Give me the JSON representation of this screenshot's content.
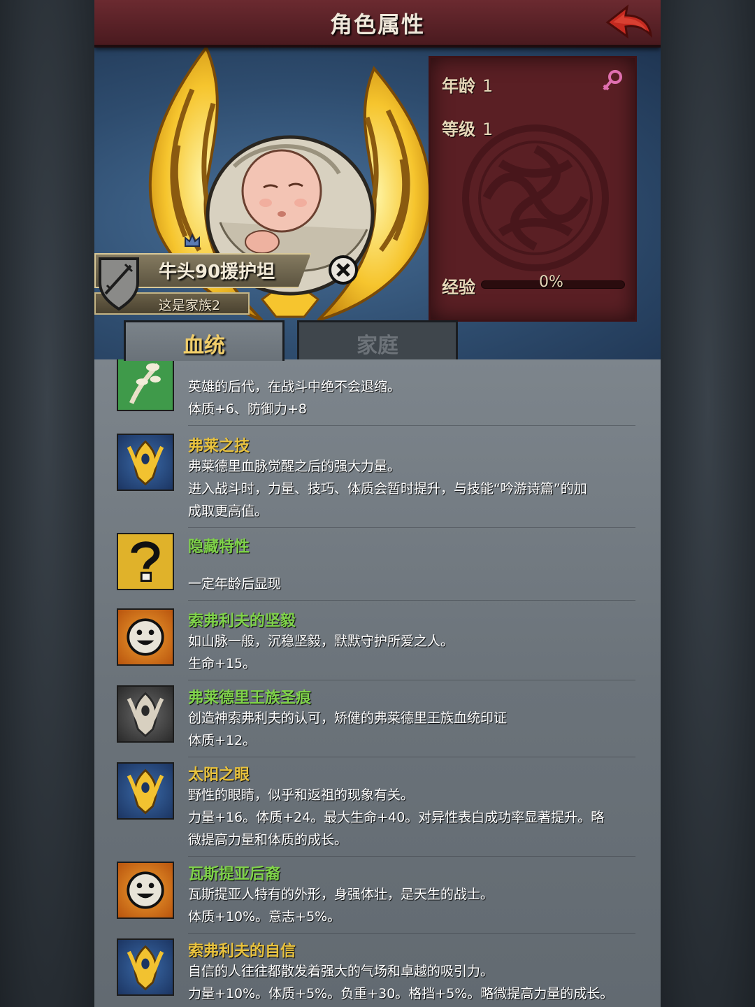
{
  "header": {
    "title": "角色属性",
    "back_icon": "back-arrow-icon"
  },
  "stats": {
    "age_label": "年龄",
    "age_value": "1",
    "level_label": "等级",
    "level_value": "1",
    "exp_label": "经验",
    "exp_value": "0%",
    "exp_fraction": 0,
    "gender_icon": "female-icon",
    "accent": "#5a1f24"
  },
  "character": {
    "name": "牛头90援护坦",
    "family": "这是家族2"
  },
  "tabs": [
    {
      "label": "血统",
      "active": true
    },
    {
      "label": "家庭",
      "active": false
    }
  ],
  "traits": [
    {
      "name": "",
      "icon": "branch-icon",
      "desc1": "英雄的后代，在战斗中绝不会退缩。",
      "desc2": "体质+6、防御力+8",
      "desc3": "",
      "color": "green"
    },
    {
      "name": "弗莱之技",
      "icon": "golden-crest-icon",
      "desc1": "弗莱德里血脉觉醒之后的强大力量。",
      "desc2": "进入战斗时，力量、技巧、体质会暂时提升，与技能“吟游诗篇”的加",
      "desc3": "成取更高值。",
      "color": "yellow"
    },
    {
      "name": "隐藏特性",
      "icon": "question-mark-icon",
      "desc1": "",
      "desc2": "一定年龄后显现",
      "desc3": "",
      "color": "green"
    },
    {
      "name": "索弗利夫的坚毅",
      "icon": "smiley-face-icon",
      "desc1": "如山脉一般，沉稳坚毅，默默守护所爱之人。",
      "desc2": "生命+15。",
      "desc3": "",
      "color": "green"
    },
    {
      "name": "弗莱德里王族圣痕",
      "icon": "silver-crest-icon",
      "desc1": "创造神索弗利夫的认可，矫健的弗莱德里王族血统印证",
      "desc2": "体质+12。",
      "desc3": "",
      "color": "green"
    },
    {
      "name": "太阳之眼",
      "icon": "golden-crest-icon",
      "desc1": "野性的眼睛，似乎和返祖的现象有关。",
      "desc2": "力量+16。体质+24。最大生命+40。对异性表白成功率显著提升。略",
      "desc3": "微提高力量和体质的成长。",
      "color": "yellow"
    },
    {
      "name": "瓦斯提亚后裔",
      "icon": "smiley-face-icon",
      "desc1": "瓦斯提亚人特有的外形，身强体壮，是天生的战士。",
      "desc2": "体质+10%。意志+5%。",
      "desc3": "",
      "color": "green"
    },
    {
      "name": "索弗利夫的自信",
      "icon": "golden-crest-icon",
      "desc1": "自信的人往往都散发着强大的气场和卓越的吸引力。",
      "desc2": "力量+10%。体质+5%。负重+30。格挡+5%。略微提高力量的成长。",
      "desc3": "",
      "color": "yellow"
    }
  ]
}
